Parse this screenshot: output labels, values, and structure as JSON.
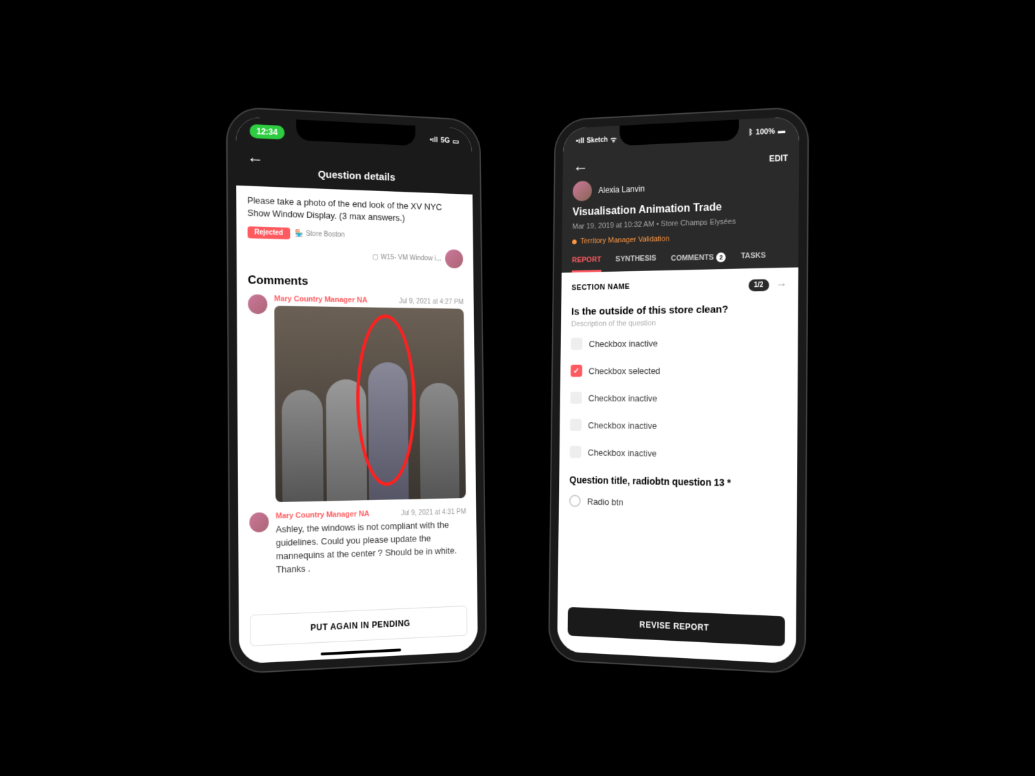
{
  "leftPhone": {
    "statusBar": {
      "time": "12:34",
      "network": "5G",
      "carrier": ""
    },
    "header": {
      "title": "Question details"
    },
    "question": "Please take a photo of the end look of the XV NYC Show Window Display. (3 max answers.)",
    "tags": {
      "rejected": "Rejected",
      "store": "Store Boston",
      "window": "W15- VM Window i..."
    },
    "commentsTitle": "Comments",
    "comments": [
      {
        "author": "Mary Country Manager NA",
        "time": "Jul 9, 2021 at 4:27 PM",
        "hasImage": true
      },
      {
        "author": "Mary Country Manager NA",
        "time": "Jul 9, 2021 at 4:31 PM",
        "text": "Ashley, the windows is not compliant with the guidelines. Could you please update the mannequins at the center ? Should be in white. Thanks ."
      }
    ],
    "bottomButton": "PUT AGAIN IN PENDING"
  },
  "rightPhone": {
    "statusBar": {
      "carrier": "Sketch",
      "battery": "100%"
    },
    "header": {
      "editLabel": "EDIT"
    },
    "user": {
      "name": "Alexia Lanvin"
    },
    "report": {
      "title": "Visualisation Animation Trade",
      "meta": "Mar 19, 2019 at 10:32 AM  •  Store Champs Elysées",
      "status": "Territory Manager Validation"
    },
    "tabs": [
      {
        "label": "REPORT",
        "active": true
      },
      {
        "label": "SYNTHESIS"
      },
      {
        "label": "COMMENTS",
        "badge": "2"
      },
      {
        "label": "TASKS"
      }
    ],
    "section": {
      "name": "SECTION NAME",
      "page": "1/2"
    },
    "question1": {
      "title": "Is the outside of this store clean?",
      "desc": "Description of the question",
      "options": [
        {
          "label": "Checkbox inactive",
          "checked": false
        },
        {
          "label": "Checkbox selected",
          "checked": true
        },
        {
          "label": "Checkbox inactive",
          "checked": false
        },
        {
          "label": "Checkbox inactive",
          "checked": false
        },
        {
          "label": "Checkbox inactive",
          "checked": false
        }
      ]
    },
    "question2": {
      "title": "Question title, radiobtn question 13 *",
      "options": [
        {
          "label": "Radio btn"
        }
      ]
    },
    "bottomButton": "REVISE REPORT"
  }
}
